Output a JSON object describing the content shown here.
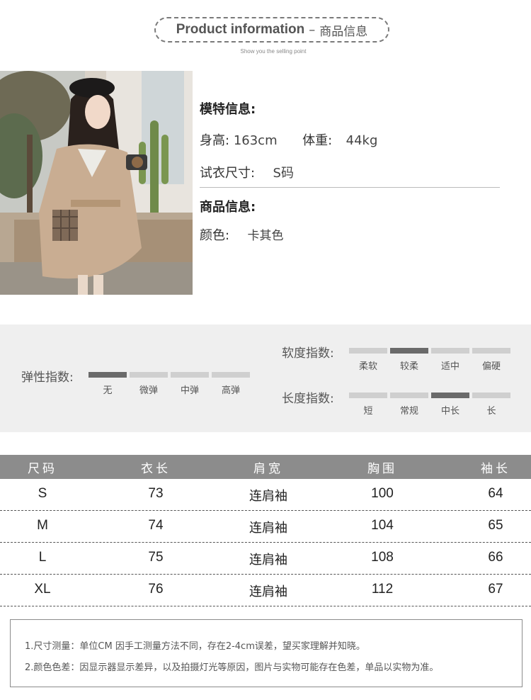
{
  "header": {
    "title_en": "Product information",
    "dash": "–",
    "title_cn": "商品信息",
    "subtitle": "Show you the selling point"
  },
  "model": {
    "heading": "模特信息:",
    "height_label": "身高:",
    "height_value": "163cm",
    "weight_label": "体重:",
    "weight_value": "44kg",
    "size_label": "试衣尺寸:",
    "size_value": "S码"
  },
  "product": {
    "heading": "商品信息:",
    "color_label": "颜色:",
    "color_value": "卡其色"
  },
  "indices": {
    "elasticity": {
      "label": "弹性指数:",
      "options": [
        "无",
        "微弹",
        "中弹",
        "高弹"
      ],
      "selected_index": 0
    },
    "softness": {
      "label": "软度指数:",
      "options": [
        "柔软",
        "较柔",
        "适中",
        "偏硬"
      ],
      "selected_index": 1
    },
    "length": {
      "label": "长度指数:",
      "options": [
        "短",
        "常规",
        "中长",
        "长"
      ],
      "selected_index": 2
    }
  },
  "size_table": {
    "headers": [
      "尺码",
      "衣长",
      "肩宽",
      "胸围",
      "袖长"
    ],
    "rows": [
      [
        "S",
        "73",
        "连肩袖",
        "100",
        "64"
      ],
      [
        "M",
        "74",
        "连肩袖",
        "104",
        "65"
      ],
      [
        "L",
        "75",
        "连肩袖",
        "108",
        "66"
      ],
      [
        "XL",
        "76",
        "连肩袖",
        "112",
        "67"
      ]
    ]
  },
  "notes": [
    "1.尺寸测量：单位CM 因手工测量方法不同，存在2-4cm误差，望买家理解并知晓。",
    "2.颜色色差：因显示器显示差异，以及拍摄灯光等原因，图片与实物可能存在色差，单品以实物为准。"
  ],
  "colors": {
    "band_bg": "#efefef",
    "bar_active": "#6a6a6a",
    "bar_inactive": "#cfcfcf",
    "table_header": "#8c8c8c",
    "coat_khaki": "#c9ad92"
  }
}
